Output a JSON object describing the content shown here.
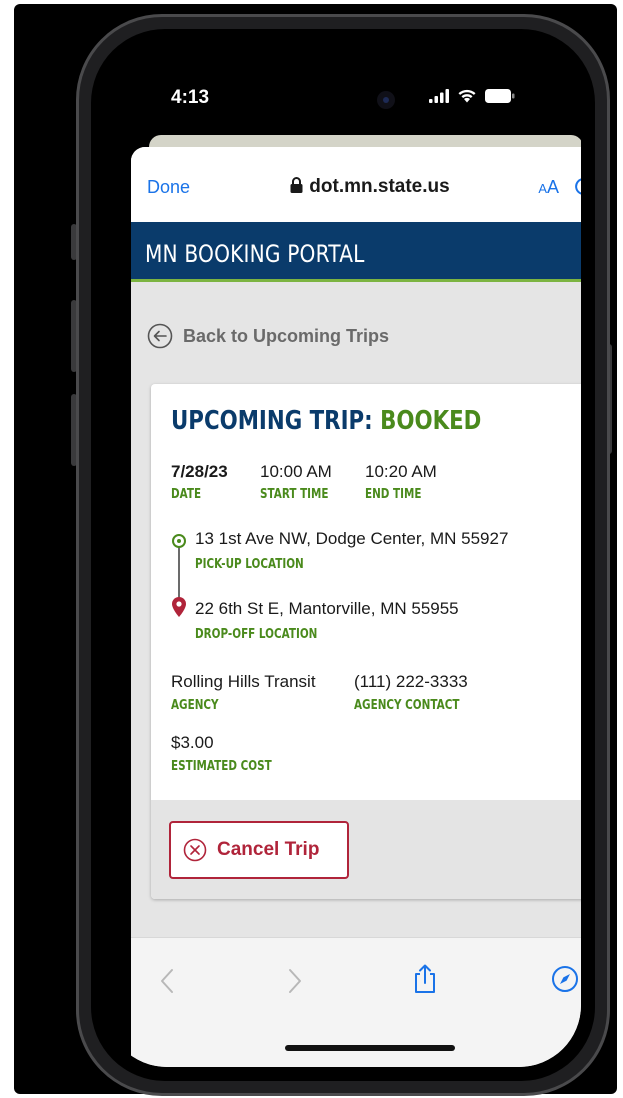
{
  "status_bar": {
    "time": "4:13",
    "signal_icon": "cellular-signal-icon",
    "wifi_icon": "wifi-icon",
    "battery_icon": "battery-icon"
  },
  "browser": {
    "done_label": "Done",
    "url": "dot.mn.state.us",
    "text_size_label_small": "A",
    "text_size_label_large": "A",
    "lock_icon": "lock-icon",
    "reload_icon": "reload-icon"
  },
  "portal": {
    "title": "MN BOOKING PORTAL",
    "back_link": "Back to Upcoming Trips"
  },
  "trip": {
    "title_prefix": "UPCOMING TRIP: ",
    "status": "BOOKED",
    "date": "7/28/23",
    "date_label": "DATE",
    "start_time": "10:00 AM",
    "start_time_label": "START TIME",
    "end_time": "10:20 AM",
    "end_time_label": "END TIME",
    "pickup": "13 1st Ave NW, Dodge Center, MN 55927",
    "pickup_label": "PICK-UP LOCATION",
    "dropoff": "22 6th St E, Mantorville, MN 55955",
    "dropoff_label": "DROP-OFF LOCATION",
    "agency": "Rolling Hills Transit",
    "agency_label": "AGENCY",
    "agency_contact": "(111) 222-3333",
    "agency_contact_label": "AGENCY CONTACT",
    "cost": "$3.00",
    "cost_label": "ESTIMATED COST",
    "cancel_label": "Cancel Trip"
  },
  "colors": {
    "header_navy": "#0a3b6b",
    "accent_green": "#4a8a1c",
    "cancel_red": "#b0243a",
    "link_blue": "#1a73e8"
  }
}
